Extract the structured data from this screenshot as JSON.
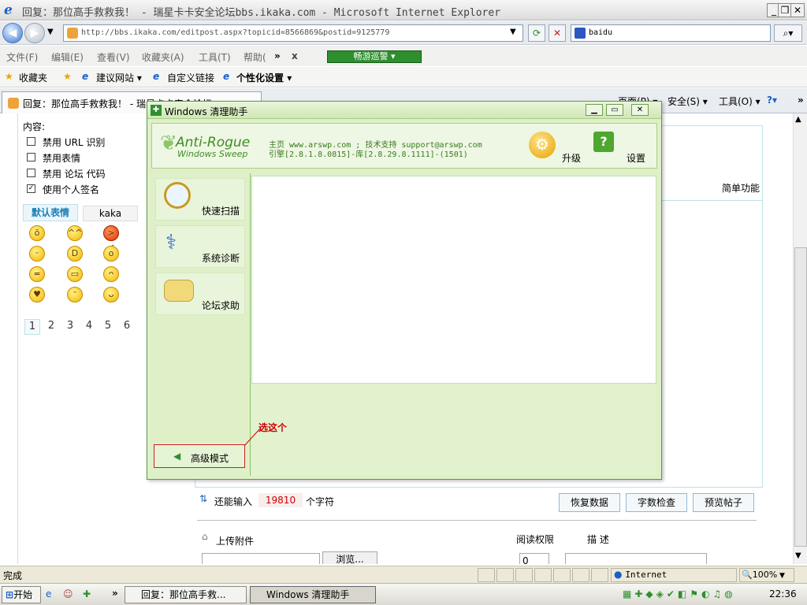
{
  "window": {
    "title": "回复：那位高手救救我！ - 瑞星卡卡安全论坛bbs.ikaka.com - Microsoft Internet Explorer",
    "minimize": "_",
    "restore": "❐",
    "close": "✕"
  },
  "address": {
    "url": "http://bbs.ikaka.com/editpost.aspx?topicid=8566869&postid=9125779",
    "search_value": "baidu"
  },
  "menu": {
    "items": [
      "文件(F)",
      "编辑(E)",
      "查看(V)",
      "收藏夹(A)",
      "工具(T)",
      "帮助("
    ],
    "more": "»",
    "close": "x",
    "tour_label": "畅游巡警"
  },
  "favorites": {
    "label": "收藏夹",
    "suggest": "建议网站",
    "custom": "自定义链接",
    "personal": "个性化设置"
  },
  "tab": {
    "title": "回复：那位高手救救我！ - 瑞星卡卡安全论坛",
    "page": "页面(P)",
    "safety": "安全(S)",
    "tools": "工具(O)"
  },
  "page": {
    "content_label": "内容:",
    "options": [
      {
        "label": "禁用 URL 识别",
        "checked": false
      },
      {
        "label": "禁用表情",
        "checked": false
      },
      {
        "label": "禁用 论坛 代码",
        "checked": false
      },
      {
        "label": "使用个人签名",
        "checked": true
      }
    ],
    "emo_tabs": [
      "默认表情",
      "kaka"
    ],
    "pages": [
      "1",
      "2",
      "3",
      "4",
      "5",
      "6"
    ],
    "simple_mode": "简单功能",
    "remaining_label": "还能输入",
    "remaining_count": "19810",
    "remaining_unit": "个字符",
    "restore_btn": "恢复数据",
    "count_btn": "字数检查",
    "preview_btn": "预览帖子",
    "upload_label": "上传附件",
    "browse_btn": "浏览...",
    "read_perm": "阅读权限",
    "desc": "描 述",
    "perm_value": "0"
  },
  "dialog": {
    "title": "Windows 清理助手",
    "logo_main": "Anti-Rogue",
    "logo_sub": "Windows Sweep",
    "info_line1": "主页 www.arswp.com ; 技术支持 support@arswp.com",
    "info_line2": "引擎[2.8.1.8.0815]-库[2.8.29.8.1111]-(1501)",
    "upgrade": "升级",
    "settings": "设置",
    "menu": [
      "快速扫描",
      "系统诊断",
      "论坛求助"
    ],
    "advanced": "高级模式",
    "annotation": "选这个"
  },
  "status": {
    "text": "完成",
    "zone": "Internet",
    "zoom": "100%"
  },
  "taskbar": {
    "start": "开始",
    "tasks": [
      "回复：那位高手救...",
      "Windows 清理助手"
    ],
    "more": "»",
    "time": "22:36"
  },
  "colors": {
    "dialog_bg": "#dff0c9",
    "dialog_border": "#5d9a3d",
    "annotation": "#cc0000",
    "accent_blue": "#1a5fc9"
  }
}
